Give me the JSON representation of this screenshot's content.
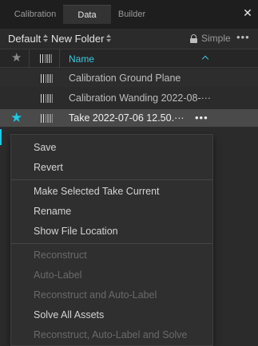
{
  "tabs": [
    {
      "label": "Calibration"
    },
    {
      "label": "Data"
    },
    {
      "label": "Builder"
    }
  ],
  "close_label": "✕",
  "toolbar": {
    "project": "Default",
    "folder": "New Folder",
    "mode": "Simple",
    "more": "•••"
  },
  "table": {
    "name_header": "Name",
    "sort": "ascending",
    "rows": [
      {
        "name": "Calibration Ground Plane",
        "starred": false,
        "selected": false
      },
      {
        "name": "Calibration Wanding 2022-08-···",
        "starred": false,
        "selected": false
      },
      {
        "name": "Take 2022-07-06 12.50.···",
        "starred": true,
        "selected": true,
        "more": "•••"
      }
    ]
  },
  "context_menu": {
    "items": [
      {
        "label": "Save",
        "enabled": true
      },
      {
        "label": "Revert",
        "enabled": true
      },
      {
        "label": "Make Selected Take Current",
        "enabled": true
      },
      {
        "label": "Rename",
        "enabled": true
      },
      {
        "label": "Show File Location",
        "enabled": true
      },
      {
        "label": "Reconstruct",
        "enabled": false
      },
      {
        "label": "Auto-Label",
        "enabled": false
      },
      {
        "label": "Reconstruct and Auto-Label",
        "enabled": false
      },
      {
        "label": "Solve All Assets",
        "enabled": true
      },
      {
        "label": "Reconstruct, Auto-Label and Solve",
        "enabled": false
      }
    ]
  },
  "colors": {
    "accent": "#1ec7e6",
    "background": "#2b2b2b",
    "menu_background": "#2f2f2f"
  },
  "icons": {
    "star": "star-icon",
    "bars": "barcode-icon",
    "lock": "lock-icon",
    "sort": "chevron-up-icon",
    "close": "close-icon"
  }
}
